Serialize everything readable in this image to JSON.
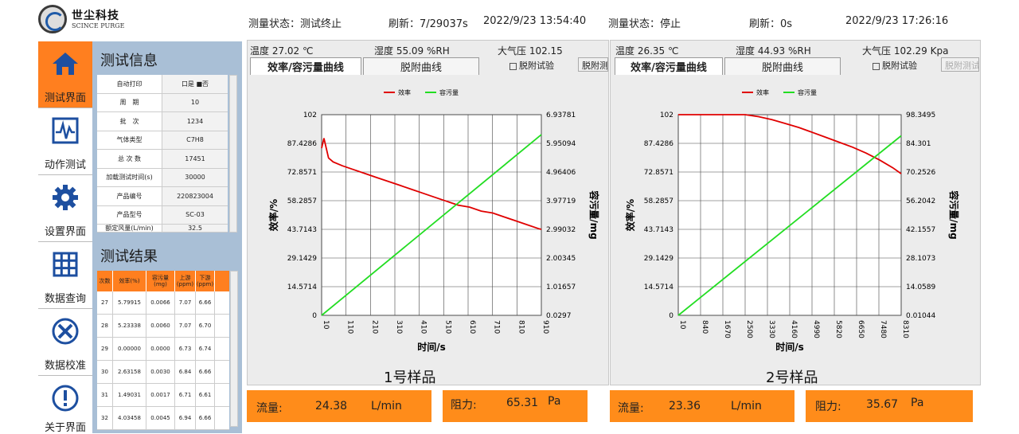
{
  "logo": {
    "cn": "世尘科技",
    "en": "SCINCE PURGE"
  },
  "nav": [
    {
      "label": "测试界面",
      "icon": "home-icon"
    },
    {
      "label": "动作测试",
      "icon": "waveform-icon"
    },
    {
      "label": "设置界面",
      "icon": "gear-icon"
    },
    {
      "label": "数据查询",
      "icon": "grid-icon"
    },
    {
      "label": "数据校准",
      "icon": "tools-icon"
    },
    {
      "label": "关于界面",
      "icon": "info-icon"
    }
  ],
  "info": {
    "title": "测试信息",
    "rows": [
      {
        "k": "自动打印",
        "v": "口是  ■否"
      },
      {
        "k": "周　期",
        "v": "10"
      },
      {
        "k": "批　次",
        "v": "1234"
      },
      {
        "k": "气体类型",
        "v": "C7H8"
      },
      {
        "k": "总 次 数",
        "v": "17451"
      },
      {
        "k": "加载测试时间(s)",
        "v": "30000"
      },
      {
        "k": "产品编号",
        "v": "220823004"
      },
      {
        "k": "产品型号",
        "v": "SC-03"
      },
      {
        "k": "额定风量(L/min)",
        "v": "32.5"
      }
    ]
  },
  "results": {
    "title": "测试结果",
    "headers": [
      "次数",
      "效率(%)",
      "容污量(mg)",
      "上游(ppm)",
      "下游(ppm)"
    ],
    "rows": [
      [
        "27",
        "5.79915",
        "0.0066",
        "7.07",
        "6.66"
      ],
      [
        "28",
        "5.23338",
        "0.0060",
        "7.07",
        "6.70"
      ],
      [
        "29",
        "0.00000",
        "0.0000",
        "6.73",
        "6.74"
      ],
      [
        "30",
        "2.63158",
        "0.0030",
        "6.84",
        "6.66"
      ],
      [
        "31",
        "1.49031",
        "0.0017",
        "6.71",
        "6.61"
      ],
      [
        "32",
        "4.03458",
        "0.0045",
        "6.94",
        "6.66"
      ]
    ]
  },
  "left_panel": {
    "status": "测量状态：测试终止",
    "refresh": "刷新：7/29037s",
    "datetime": "2022/9/23 13:54:40",
    "temp": "温度 27.02 ℃",
    "humidity": "湿度 55.09 %RH",
    "pressure": "大气压 102.15",
    "tab_active": "效率/容污量曲线",
    "tab_inactive": "脱附曲线",
    "checkbox": "脱附试验",
    "button": "脱附测",
    "sample": "1号样品",
    "flow_label": "流量:",
    "flow_value": "24.38",
    "flow_unit": "L/min",
    "res_label": "阻力:",
    "res_value": "65.31",
    "res_unit": "Pa"
  },
  "right_panel": {
    "status": "测量状态：停止",
    "refresh": "刷新：0s",
    "datetime": "2022/9/23 17:26:16",
    "temp": "温度 26.35 ℃",
    "humidity": "湿度 44.93 %RH",
    "pressure": "大气压 102.29 Kpa",
    "tab_active": "效率/容污量曲线",
    "tab_inactive": "脱附曲线",
    "checkbox": "脱附试验",
    "button": "脱附测试",
    "sample": "2号样品",
    "flow_label": "流量:",
    "flow_value": "23.36",
    "flow_unit": "L/min",
    "res_label": "阻力:",
    "res_value": "35.67",
    "res_unit": "Pa"
  },
  "colors": {
    "accent": "#ff7f1f",
    "efficiency": "#e00000",
    "capacity": "#22dd22",
    "panel": "#a9bfd6"
  },
  "chart_data": [
    {
      "type": "line",
      "xlabel": "时间/s",
      "ylabel_left": "效率/%",
      "ylabel_right": "容污量/mg",
      "legend": [
        "效率",
        "容污量"
      ],
      "x_ticks": [
        "10",
        "110",
        "210",
        "310",
        "410",
        "510",
        "610",
        "710",
        "810",
        "910"
      ],
      "y_ticks_left": [
        "102",
        "87.4286",
        "72.8571",
        "58.2857",
        "43.7143",
        "29.1429",
        "14.5714",
        "0"
      ],
      "y_ticks_right": [
        "6.93781",
        "5.95094",
        "4.96406",
        "3.97719",
        "2.99032",
        "2.00345",
        "1.01657",
        "0.0297"
      ],
      "xlim": [
        10,
        960
      ],
      "ylim_left": [
        0,
        102
      ],
      "ylim_right": [
        0.0297,
        6.93781
      ],
      "series": [
        {
          "name": "效率",
          "axis": "left",
          "x": [
            10,
            20,
            30,
            40,
            60,
            100,
            150,
            200,
            250,
            300,
            350,
            400,
            450,
            500,
            550,
            600,
            650,
            700,
            750,
            800,
            850,
            900,
            950,
            960
          ],
          "y": [
            85,
            90,
            85,
            80,
            78,
            76,
            74,
            72,
            70,
            68,
            66,
            64,
            62,
            60,
            58,
            56,
            55,
            53,
            52,
            50,
            48,
            46,
            44,
            43.7
          ]
        },
        {
          "name": "容污量",
          "axis": "right",
          "x": [
            10,
            960
          ],
          "y": [
            0.0297,
            6.25
          ]
        }
      ]
    },
    {
      "type": "line",
      "xlabel": "时间/s",
      "ylabel_left": "效率/%",
      "ylabel_right": "容污量/mg",
      "legend": [
        "效率",
        "容污量"
      ],
      "x_ticks": [
        "10",
        "840",
        "1670",
        "2500",
        "3330",
        "4160",
        "4990",
        "5820",
        "6650",
        "7480",
        "8310"
      ],
      "y_ticks_left": [
        "102",
        "87.4286",
        "72.8571",
        "58.2857",
        "43.7143",
        "29.1429",
        "14.5714",
        "0"
      ],
      "y_ticks_right": [
        "98.3495",
        "84.301",
        "70.2526",
        "56.2042",
        "42.1557",
        "28.1073",
        "14.0589",
        "0.01044"
      ],
      "xlim": [
        10,
        8310
      ],
      "ylim_left": [
        0,
        102
      ],
      "ylim_right": [
        0.01044,
        98.3495
      ],
      "series": [
        {
          "name": "效率",
          "axis": "left",
          "x": [
            10,
            1000,
            2000,
            2500,
            3000,
            3500,
            4000,
            4500,
            5000,
            5500,
            6000,
            6500,
            7000,
            7500,
            8000,
            8310
          ],
          "y": [
            102,
            102,
            102,
            102,
            101,
            99.5,
            97.5,
            95.5,
            93,
            90.5,
            88,
            85.5,
            82.5,
            79,
            75,
            72
          ]
        },
        {
          "name": "容污量",
          "axis": "right",
          "x": [
            10,
            8310
          ],
          "y": [
            0.01044,
            88
          ]
        }
      ]
    }
  ]
}
